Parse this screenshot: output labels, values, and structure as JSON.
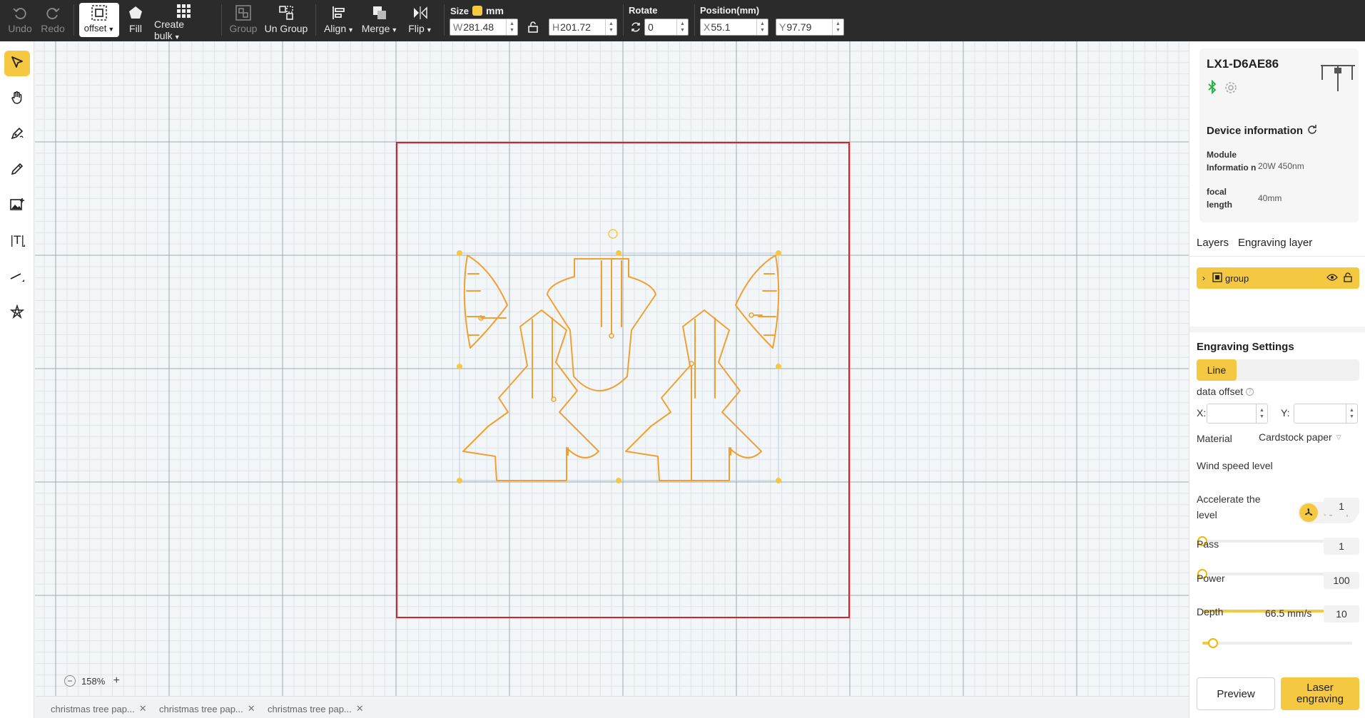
{
  "toolbar": {
    "undo": "Undo",
    "redo": "Redo",
    "offset": "offset",
    "fill": "Fill",
    "create_bulk": "Create bulk",
    "group": "Group",
    "ungroup": "Un Group",
    "align": "Align",
    "merge": "Merge",
    "flip": "Flip",
    "size_label": "Size",
    "unit": "mm",
    "width_prefix": "W",
    "width_value": "281.48",
    "height_prefix": "H",
    "height_value": "201.72",
    "rotate_label": "Rotate",
    "rotate_value": "0",
    "position_label": "Position(mm)",
    "x_prefix": "X",
    "x_value": "55.1",
    "y_prefix": "Y",
    "y_value": "97.79"
  },
  "left_tools": [
    "select-icon",
    "hand-icon",
    "pen-icon",
    "pencil-icon",
    "image-icon",
    "text-icon",
    "line-icon",
    "shape-icon"
  ],
  "canvas": {
    "zoom": "158%",
    "accent": "#f0a030",
    "work_area_color": "#e02020"
  },
  "tabs": [
    {
      "label": "christmas tree pap..."
    },
    {
      "label": "christmas tree pap..."
    },
    {
      "label": "christmas tree pap..."
    }
  ],
  "device": {
    "name": "LX1-D6AE86",
    "info_title": "Device information",
    "module_label": "Module Informatio n",
    "module_value": "20W 450nm",
    "focal_label": "focal length",
    "focal_value": "40mm"
  },
  "panel_tabs": {
    "layers": "Layers",
    "engraving_layer": "Engraving layer"
  },
  "layer": {
    "name": "group"
  },
  "engraving": {
    "title": "Engraving Settings",
    "mode": "Line",
    "data_offset_label": "data offset",
    "x_label": "X:",
    "y_label": "Y:",
    "material_label": "Material",
    "material_value": "Cardstock paper",
    "wind_label": "Wind speed level",
    "accelerate_label": "Accelerate the level",
    "accelerate_value": "1",
    "accelerate_level": 0,
    "pass_label": "Pass",
    "pass_value": "1",
    "pass_level": 0,
    "power_label": "Power",
    "power_value": "100",
    "power_level": 1.0,
    "depth_label": "Depth",
    "depth_speed": "66.5 mm/s",
    "depth_value": "10",
    "depth_level": 0.07
  },
  "buttons": {
    "preview": "Preview",
    "laser": "Laser engraving"
  },
  "colors": {
    "accent_yellow": "#f5c842",
    "toolbar_bg": "#2b2b2b",
    "shape_orange": "#f0a030",
    "work_area_red": "#e02020"
  }
}
